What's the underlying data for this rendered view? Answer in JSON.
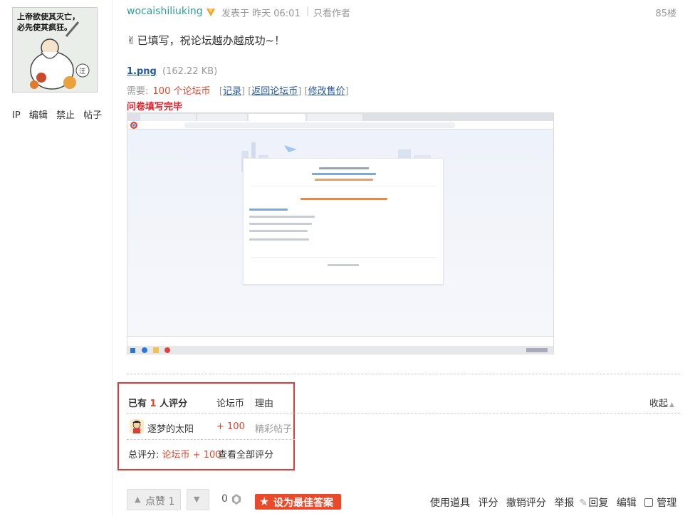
{
  "left": {
    "actions": [
      "IP",
      "编辑",
      "禁止",
      "帖子"
    ],
    "avatar_text": "上帝欲使其灭亡，必先使其疯狂。"
  },
  "post": {
    "author": "wocaishiliuking",
    "posted": "发表于 昨天 06:01",
    "separator": "|",
    "only_author": "只看作者",
    "floor": "85楼",
    "greeting": "已填写，祝论坛越办越成功~！",
    "attachment": {
      "name": "1.png",
      "size": "(162.22 KB)",
      "need_label": "需要:",
      "cost": "100 个论坛币",
      "link_record": "记录",
      "link_back": "返回论坛币",
      "link_edit_price": "修改售价"
    },
    "survey_done": "问卷填写完毕"
  },
  "rating": {
    "header_prefix": "已有",
    "count": "1",
    "header_suffix": "人评分",
    "col_coin": "论坛币",
    "col_reason": "理由",
    "collapse": "收起",
    "rows": [
      {
        "name": "逐梦的太阳",
        "coin": "+ 100",
        "reason": "精彩帖子"
      }
    ],
    "total_label": "总评分:",
    "total_value": "论坛币 + 100",
    "view_all": "查看全部评分"
  },
  "bottom": {
    "like_label": "点赞 1",
    "coin_count": "0",
    "best_answer": "设为最佳答案",
    "actions": [
      "使用道具",
      "评分",
      "撤销评分",
      "举报",
      "回复",
      "编辑",
      "管理"
    ]
  },
  "colors": {
    "author": "#2b9f94",
    "link": "#2457a4",
    "accent_red": "#e0452b",
    "highlight_box": "#e03a36",
    "best_button": "#e84a2a"
  }
}
